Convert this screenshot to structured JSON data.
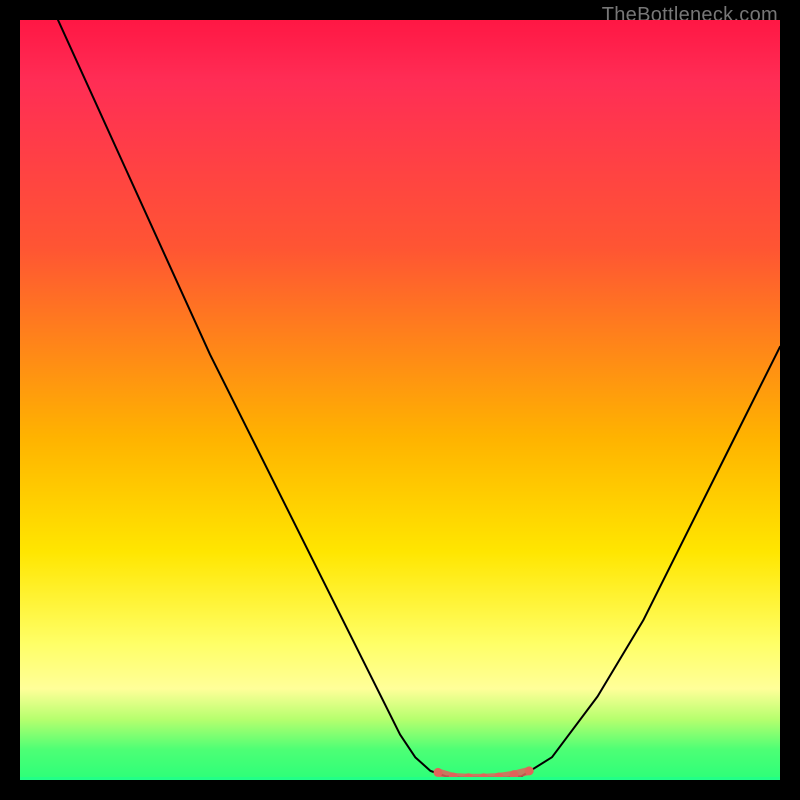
{
  "watermark": "TheBottleneck.com",
  "colors": {
    "frame": "#000000",
    "watermark": "#777777",
    "gradient_top": "#ff1744",
    "gradient_mid1": "#ff5533",
    "gradient_mid2": "#ffb300",
    "gradient_mid3": "#ffe600",
    "gradient_mid4": "#ffff99",
    "gradient_bottom": "#2cff79",
    "curve": "#000000",
    "marker": "#e0645a"
  },
  "chart_data": {
    "type": "line",
    "title": "",
    "xlabel": "",
    "ylabel": "",
    "xlim": [
      0,
      100
    ],
    "ylim": [
      0,
      100
    ],
    "series": [
      {
        "name": "left-branch",
        "x": [
          5,
          10,
          15,
          20,
          25,
          30,
          35,
          40,
          45,
          50,
          52,
          54,
          56
        ],
        "y": [
          100,
          89,
          78,
          67,
          56,
          46,
          36,
          26,
          16,
          6,
          3,
          1.2,
          0.5
        ]
      },
      {
        "name": "floor",
        "x": [
          56,
          58,
          60,
          62,
          64,
          66
        ],
        "y": [
          0.5,
          0.3,
          0.3,
          0.3,
          0.3,
          0.5
        ]
      },
      {
        "name": "right-branch",
        "x": [
          66,
          70,
          76,
          82,
          88,
          94,
          100
        ],
        "y": [
          0.5,
          3,
          11,
          21,
          33,
          45,
          57
        ]
      }
    ],
    "markers": {
      "name": "highlight-floor",
      "x": [
        55,
        57,
        59,
        61,
        63,
        65,
        67
      ],
      "y": [
        1.0,
        0.4,
        0.3,
        0.3,
        0.4,
        0.7,
        1.2
      ],
      "color": "#e0645a",
      "size": 9
    }
  }
}
